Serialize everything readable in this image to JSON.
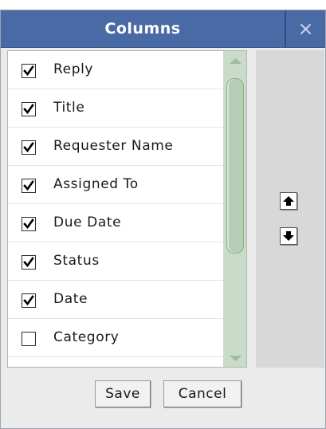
{
  "dialog": {
    "title": "Columns",
    "close_glyph": "×"
  },
  "columns": [
    {
      "label": "Reply",
      "checked": true
    },
    {
      "label": "Title",
      "checked": true
    },
    {
      "label": "Requester Name",
      "checked": true
    },
    {
      "label": "Assigned To",
      "checked": true
    },
    {
      "label": "Due Date",
      "checked": true
    },
    {
      "label": "Status",
      "checked": true
    },
    {
      "label": "Date",
      "checked": true
    },
    {
      "label": "Category",
      "checked": false
    },
    {
      "label": "",
      "checked": false
    }
  ],
  "side_panel": {
    "move_up_icon": "arrow-up-icon",
    "move_down_icon": "arrow-down-icon"
  },
  "footer": {
    "save_label": "Save",
    "cancel_label": "Cancel"
  },
  "colors": {
    "title_bar": "#4a6aa6",
    "scrollbar_track": "#c8dcc8",
    "side_panel": "#d8d8d8"
  }
}
